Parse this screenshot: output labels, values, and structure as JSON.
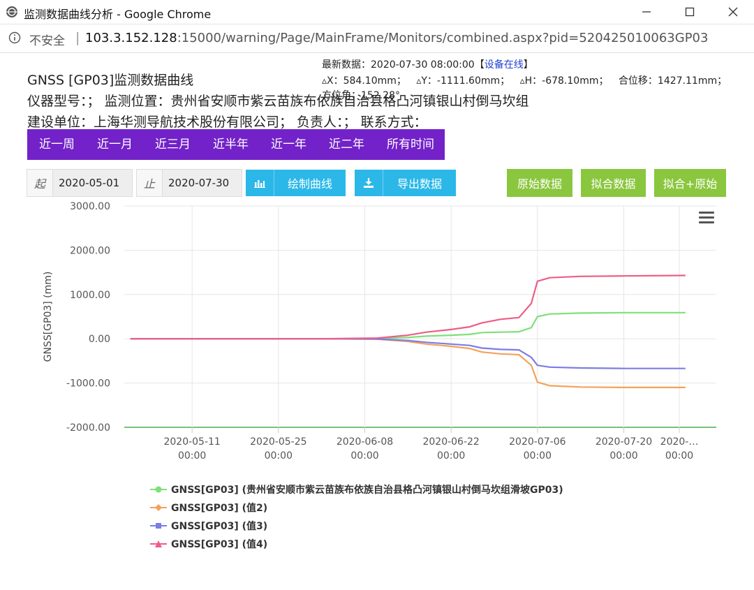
{
  "window": {
    "title": "监测数据曲线分析 - Google Chrome",
    "insecure_label": "不安全",
    "url_host": "103.3.152.128",
    "url_rest": ":15000/warning/Page/MainFrame/Monitors/combined.aspx?pid=520425010063GP03"
  },
  "header": {
    "title": "GNSS [GP03]监测数据曲线",
    "instrument": "仪器型号：；  监测位置：贵州省安顺市紫云苗族布依族自治县格凸河镇银山村倒马坎组",
    "builder": "建设单位：上海华测导航技术股份有限公司；  负责人：；  联系方式：",
    "latest_prefix": "最新数据：2020-07-30 08:00:00【",
    "latest_status": "设备在线",
    "latest_suffix": "】",
    "dx": "▵X：584.10mm；",
    "dy": "▵Y：-1111.60mm；",
    "dh": "▵H：-678.10mm；",
    "total": "合位移：1427.11mm；",
    "azimuth": "方位角：152.28°"
  },
  "periods": [
    "近一周",
    "近一月",
    "近三月",
    "近半年",
    "近一年",
    "近二年",
    "所有时间"
  ],
  "filters": {
    "start_label": "起",
    "start_value": "2020-05-01",
    "end_label": "止",
    "end_value": "2020-07-30",
    "draw_button": "绘制曲线",
    "export_button": "导出数据",
    "raw_button": "原始数据",
    "fit_button": "拟合数据",
    "fit_raw_button": "拟合+原始"
  },
  "chart_data": {
    "type": "line",
    "ylabel": "GNSS[GP03] (mm)",
    "ylim": [
      -2000,
      3000
    ],
    "y_ticks": [
      "3000.00",
      "2000.00",
      "1000.00",
      "0.00",
      "-1000.00",
      "-2000.00"
    ],
    "x_ticks": [
      {
        "date": "2020-05-11",
        "time": "00:00"
      },
      {
        "date": "2020-05-25",
        "time": "00:00"
      },
      {
        "date": "2020-06-08",
        "time": "00:00"
      },
      {
        "date": "2020-06-22",
        "time": "00:00"
      },
      {
        "date": "2020-07-06",
        "time": "00:00"
      },
      {
        "date": "2020-07-20",
        "time": "00:00"
      },
      {
        "date": "2020-…",
        "time": "00:00"
      }
    ],
    "x": [
      "2020-05-01",
      "2020-05-15",
      "2020-06-01",
      "2020-06-10",
      "2020-06-15",
      "2020-06-18",
      "2020-06-22",
      "2020-06-25",
      "2020-06-27",
      "2020-06-30",
      "2020-07-03",
      "2020-07-05",
      "2020-07-06",
      "2020-07-08",
      "2020-07-13",
      "2020-07-20",
      "2020-07-30"
    ],
    "series": [
      {
        "name": "GNSS[GP03] (贵州省安顺市紫云苗族布依族自治县格凸河镇银山村倒马坎组滑坡GP03)",
        "color": "#7ee07a",
        "marker": "circle",
        "values": [
          0,
          0,
          0,
          5,
          30,
          60,
          80,
          100,
          140,
          150,
          160,
          250,
          500,
          560,
          580,
          590,
          590
        ]
      },
      {
        "name": "GNSS[GP03] (值2)",
        "color": "#f4a25a",
        "marker": "diamond",
        "values": [
          0,
          0,
          0,
          -10,
          -60,
          -120,
          -170,
          -220,
          -300,
          -340,
          -360,
          -600,
          -980,
          -1060,
          -1090,
          -1100,
          -1100
        ]
      },
      {
        "name": "GNSS[GP03] (值3)",
        "color": "#7b7de6",
        "marker": "square",
        "values": [
          0,
          0,
          0,
          -5,
          -40,
          -80,
          -120,
          -150,
          -210,
          -240,
          -250,
          -420,
          -600,
          -640,
          -660,
          -670,
          -670
        ]
      },
      {
        "name": "GNSS[GP03] (值4)",
        "color": "#ee5d86",
        "marker": "triangle",
        "values": [
          0,
          0,
          0,
          15,
          80,
          150,
          210,
          270,
          360,
          440,
          480,
          800,
          1300,
          1380,
          1410,
          1420,
          1430
        ]
      }
    ]
  }
}
